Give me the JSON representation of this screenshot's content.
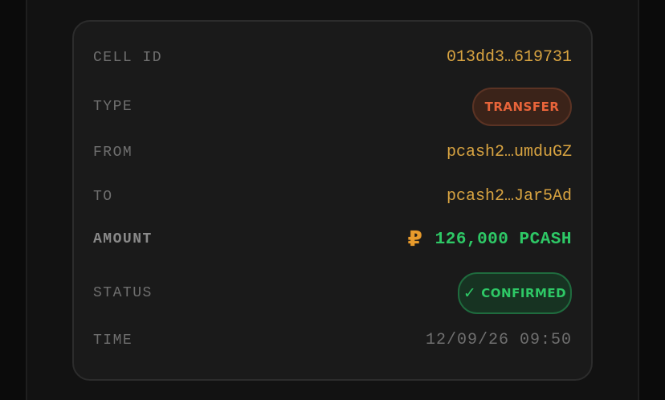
{
  "details": {
    "cell_id": {
      "label": "CELL ID",
      "value": "013dd3…619731"
    },
    "type": {
      "label": "TYPE",
      "value": "TRANSFER"
    },
    "from": {
      "label": "FROM",
      "value": "pcash2…umduGZ"
    },
    "to": {
      "label": "TO",
      "value": "pcash2…Jar5Ad"
    },
    "amount": {
      "label": "AMOUNT",
      "symbol": "₽",
      "value": "126,000 PCASH"
    },
    "status": {
      "label": "STATUS",
      "check": "✓",
      "value": "CONFIRMED"
    },
    "time": {
      "label": "TIME",
      "value": "12/09/26 09:50"
    }
  },
  "colors": {
    "accent_gold": "#d9a441",
    "transfer_orange": "#e8643a",
    "success_green": "#2ec866"
  },
  "icons": {
    "currency": "ruble-sign-icon",
    "status": "checkmark-icon"
  }
}
